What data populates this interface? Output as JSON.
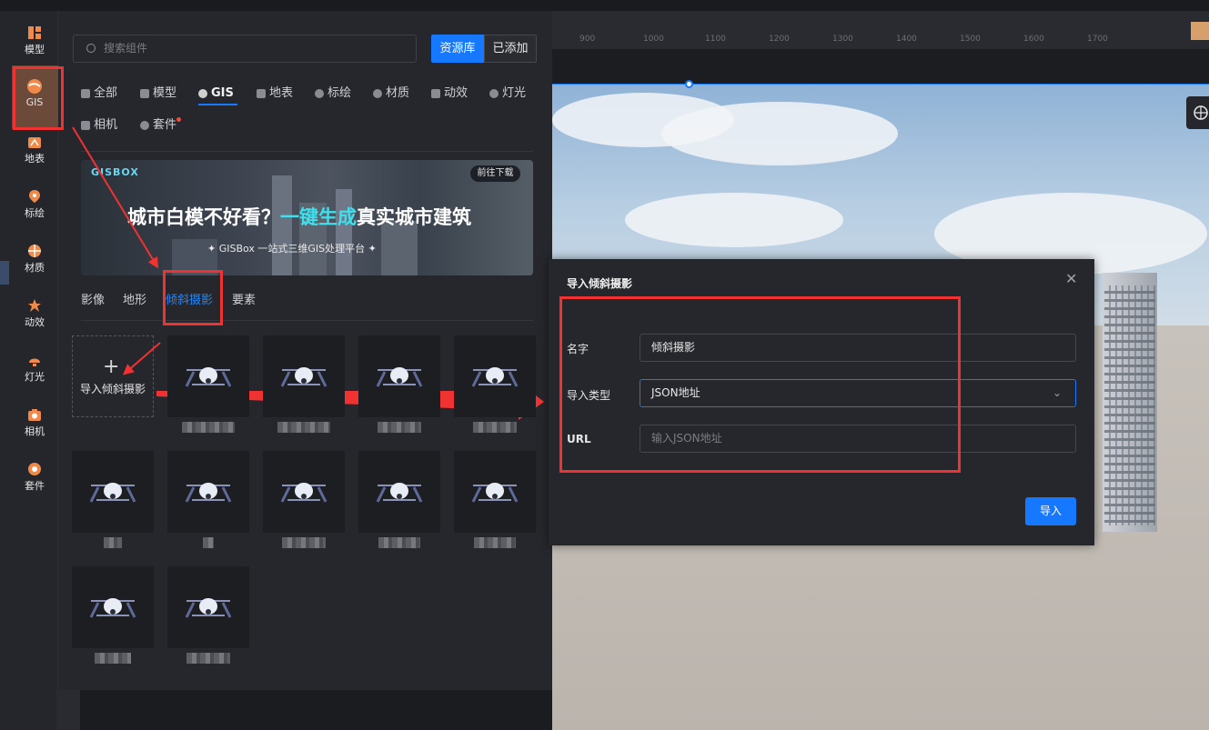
{
  "rail": {
    "items": [
      {
        "label": "模型",
        "icon": "model-icon"
      },
      {
        "label": "GIS",
        "icon": "gis-globe-icon"
      },
      {
        "label": "地表",
        "icon": "terrain-icon"
      },
      {
        "label": "标绘",
        "icon": "location-pin-icon"
      },
      {
        "label": "材质",
        "icon": "material-icon"
      },
      {
        "label": "动效",
        "icon": "effect-star-icon"
      },
      {
        "label": "灯光",
        "icon": "light-icon"
      },
      {
        "label": "相机",
        "icon": "camera-icon"
      },
      {
        "label": "套件",
        "icon": "kit-gear-icon"
      }
    ]
  },
  "panel": {
    "search_placeholder": "搜索组件",
    "btn_library": "资源库",
    "btn_added": "已添加",
    "categories": [
      "全部",
      "模型",
      "GIS",
      "地表",
      "标绘",
      "材质",
      "动效",
      "灯光",
      "相机",
      "套件"
    ],
    "banner": {
      "brand": "GISBOX",
      "download": "前往下载",
      "title_a": "城市白模不好看？",
      "title_b": "一键生成",
      "title_c": "真实城市建筑",
      "subtitle": "✦  GISBox  一站式三维GIS处理平台  ✦"
    },
    "subtabs": [
      "影像",
      "地形",
      "倾斜摄影",
      "要素"
    ],
    "add_label": "导入倾斜摄影"
  },
  "ruler": {
    "ticks": [
      "900",
      "1000",
      "1100",
      "1200",
      "1300",
      "1400",
      "1500",
      "1600",
      "1700"
    ]
  },
  "dialog": {
    "title": "导入倾斜摄影",
    "close": "✕",
    "name_label": "名字",
    "name_value": "倾斜摄影",
    "type_label": "导入类型",
    "type_value": "JSON地址",
    "url_label": "URL",
    "url_placeholder": "输入JSON地址",
    "import_button": "导入"
  },
  "colors": {
    "accent": "#1677ff",
    "annotation": "#f03232",
    "highlight": "#3fe0ee"
  }
}
